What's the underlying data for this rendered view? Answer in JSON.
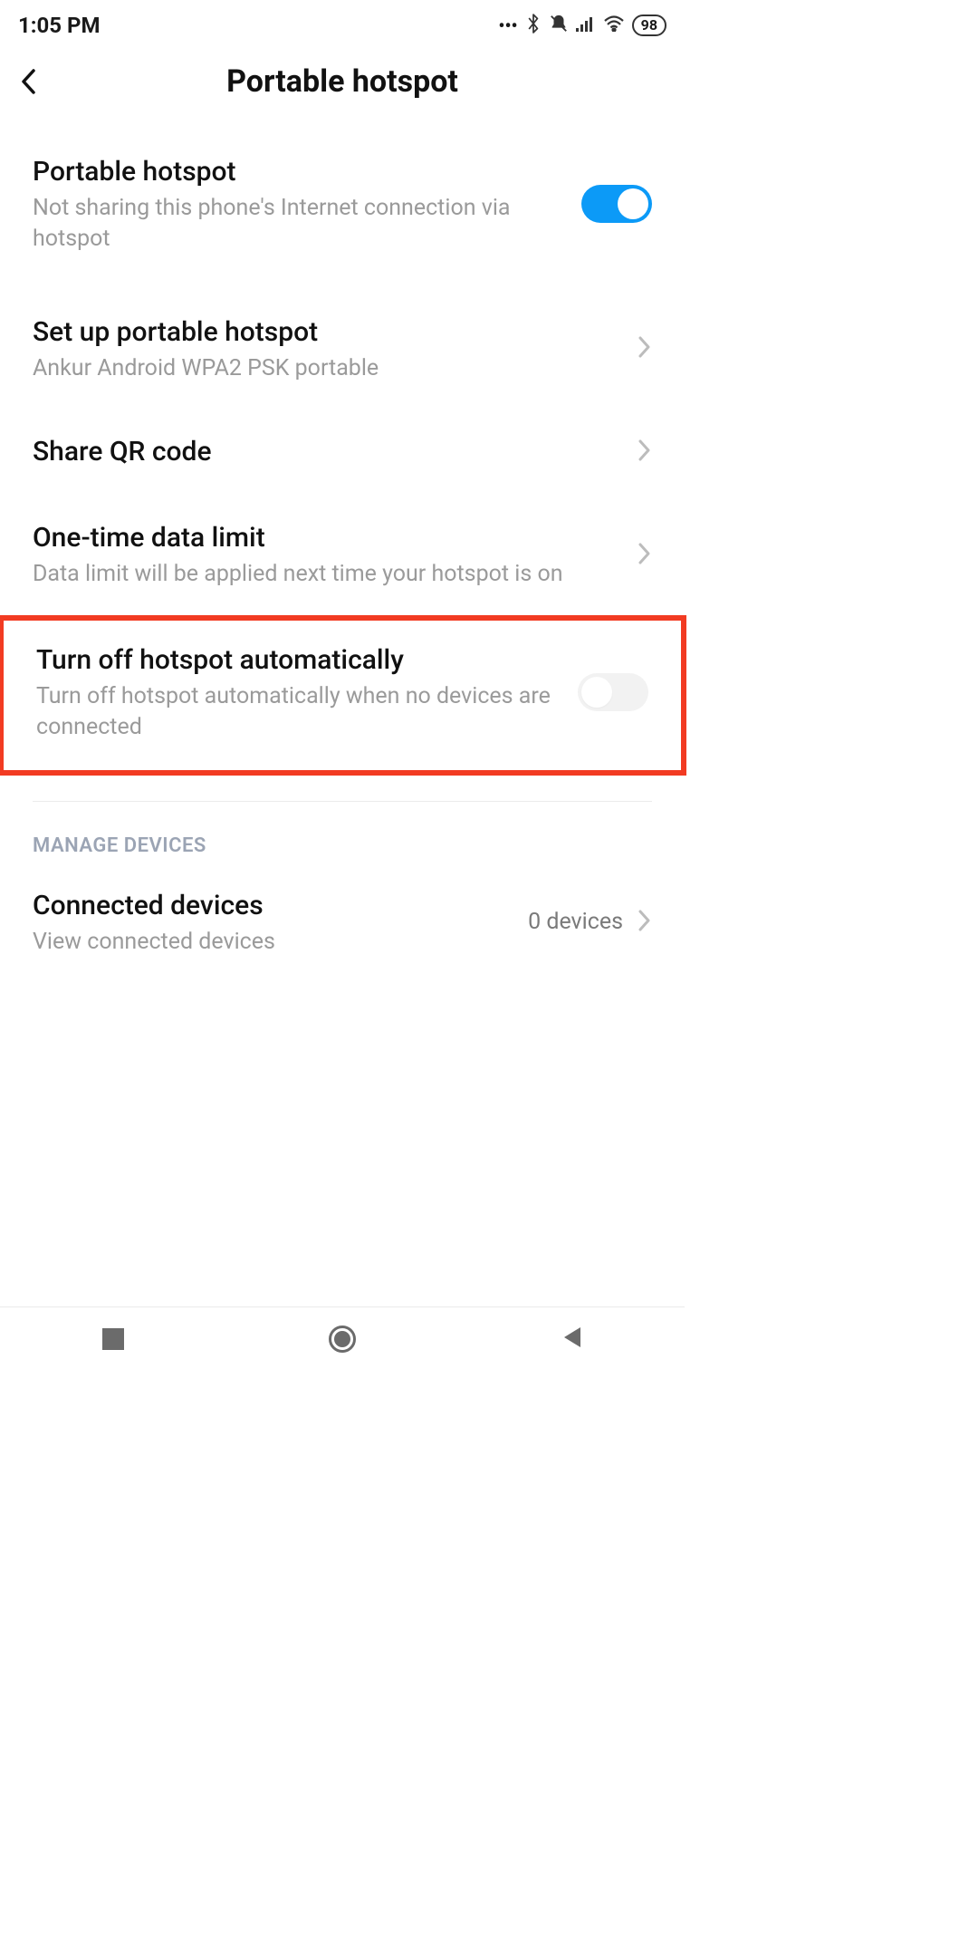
{
  "status": {
    "time": "1:05 PM",
    "battery": "98"
  },
  "header": {
    "title": "Portable hotspot"
  },
  "rows": {
    "hotspot": {
      "title": "Portable hotspot",
      "sub": "Not sharing this phone's Internet connection via hotspot"
    },
    "setup": {
      "title": "Set up portable hotspot",
      "sub": "Ankur Android WPA2 PSK portable"
    },
    "qr": {
      "title": "Share QR code"
    },
    "datalimit": {
      "title": "One-time data limit",
      "sub": "Data limit will be applied next time your hotspot is on"
    },
    "autooff": {
      "title": "Turn off hotspot automatically",
      "sub": "Turn off hotspot automatically when no devices are connected"
    },
    "connected": {
      "title": "Connected devices",
      "sub": "View connected devices",
      "value": "0 devices"
    }
  },
  "sections": {
    "manage": "MANAGE DEVICES"
  }
}
